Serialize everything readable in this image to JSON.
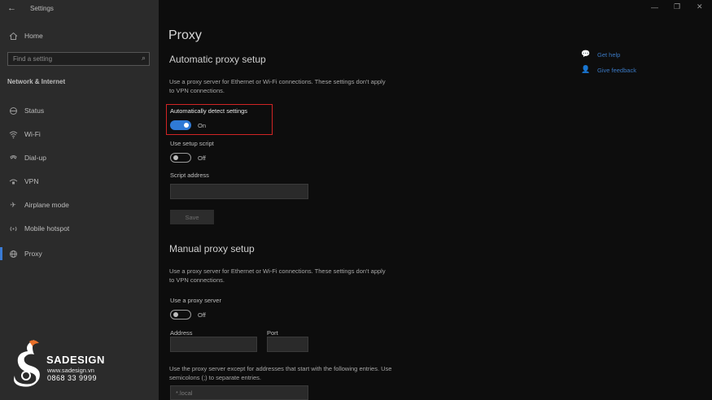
{
  "titlebar": {
    "back_icon": "back-arrow-icon",
    "title": "Settings",
    "controls": [
      "minimize-icon",
      "restore-icon",
      "close-icon"
    ]
  },
  "sidebar": {
    "home_label": "Home",
    "search_placeholder": "Find a setting",
    "section_label": "Network & Internet",
    "items": [
      {
        "label": "Status",
        "icon": "globe-status-icon"
      },
      {
        "label": "Wi-Fi",
        "icon": "wifi-icon"
      },
      {
        "label": "Dial-up",
        "icon": "dialup-icon"
      },
      {
        "label": "VPN",
        "icon": "vpn-icon"
      },
      {
        "label": "Airplane mode",
        "icon": "airplane-icon"
      },
      {
        "label": "Mobile hotspot",
        "icon": "hotspot-icon"
      },
      {
        "label": "Proxy",
        "icon": "globe-icon",
        "active": true
      }
    ]
  },
  "main": {
    "page_title": "Proxy",
    "auto": {
      "heading": "Automatic proxy setup",
      "description": "Use a proxy server for Ethernet or Wi-Fi connections. These settings don't apply to VPN connections.",
      "detect_label": "Automatically detect settings",
      "detect_state": "On",
      "script_label": "Use setup script",
      "script_state": "Off",
      "address_label": "Script address",
      "address_value": "",
      "save_label": "Save"
    },
    "manual": {
      "heading": "Manual proxy setup",
      "description": "Use a proxy server for Ethernet or Wi-Fi connections. These settings don't apply to VPN connections.",
      "use_label": "Use a proxy server",
      "use_state": "Off",
      "address_label": "Address",
      "port_label": "Port",
      "exceptions_text": "Use the proxy server except for addresses that start with the following entries. Use semicolons (;) to separate entries.",
      "exceptions_value": "*.local"
    }
  },
  "help": {
    "get_help": "Get help",
    "give_feedback": "Give feedback"
  },
  "watermark": {
    "name": "SADESIGN",
    "url": "www.sadesign.vn",
    "phone": "0868 33 9999"
  },
  "colors": {
    "accent": "#2f7ad6",
    "highlight_border": "#d12424",
    "link": "#3a78c2"
  }
}
